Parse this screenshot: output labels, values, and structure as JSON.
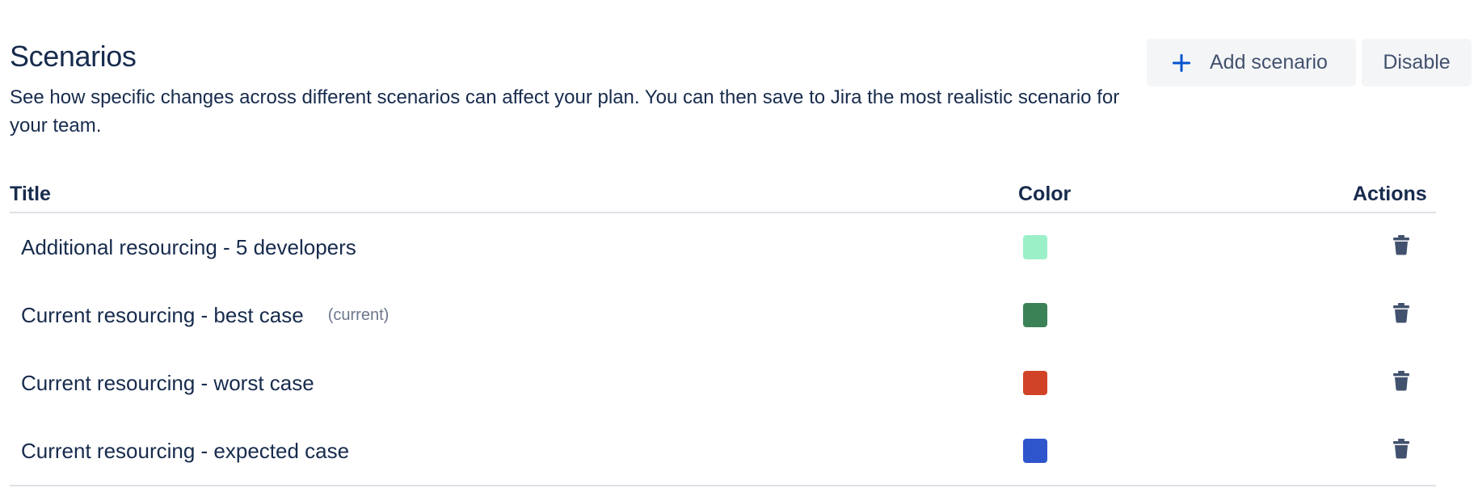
{
  "header": {
    "title": "Scenarios",
    "description": "See how specific changes across different scenarios can affect your plan. You can then save to Jira the most realistic scenario for your team."
  },
  "buttons": {
    "add_scenario": "Add scenario",
    "disable": "Disable"
  },
  "table": {
    "columns": [
      "Title",
      "Color",
      "Actions"
    ],
    "rows": [
      {
        "title": "Additional resourcing - 5 developers",
        "tag": "",
        "color": "#9bf0c8"
      },
      {
        "title": "Current resourcing - best case",
        "tag": "(current)",
        "color": "#3b8357"
      },
      {
        "title": "Current resourcing - worst case",
        "tag": "",
        "color": "#d04327"
      },
      {
        "title": "Current resourcing - expected case",
        "tag": "",
        "color": "#2f55cc"
      }
    ]
  },
  "icons": {
    "add": "plus-icon",
    "delete": "trash-icon"
  },
  "colors": {
    "accent": "#0052cc",
    "text": "#172b4d",
    "button_bg": "#f4f5f7",
    "icon": "#42526e"
  }
}
